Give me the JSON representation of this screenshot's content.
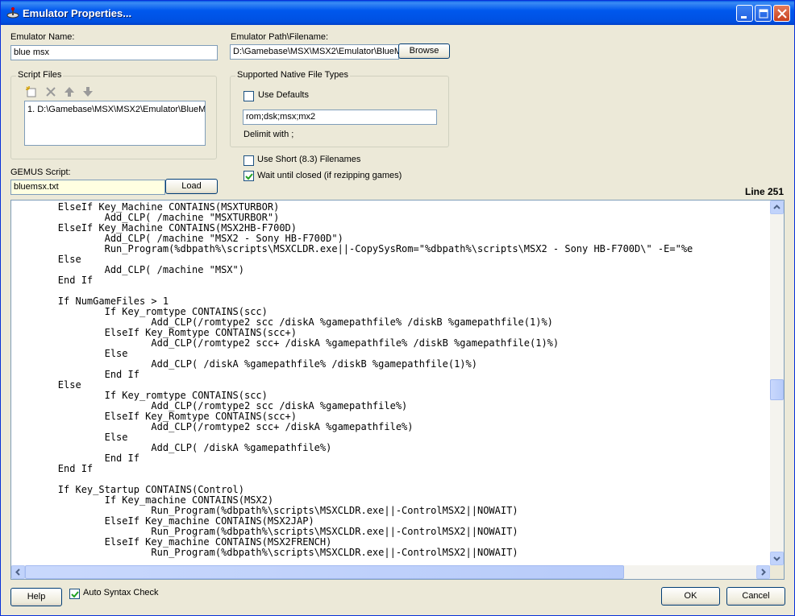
{
  "window": {
    "title": "Emulator Properties..."
  },
  "emulator_name": {
    "label": "Emulator Name:",
    "value": "blue msx"
  },
  "emulator_path": {
    "label": "Emulator Path\\Filename:",
    "value": "D:\\Gamebase\\MSX\\MSX2\\Emulator\\BlueM",
    "browse": "Browse"
  },
  "script_files": {
    "title": "Script Files",
    "items": [
      "1. D:\\Gamebase\\MSX\\MSX2\\Emulator\\BlueM"
    ]
  },
  "native_types": {
    "title": "Supported Native File Types",
    "use_defaults": "Use Defaults",
    "use_defaults_checked": false,
    "extensions": "rom;dsk;msx;mx2",
    "delimit": "Delimit with ;"
  },
  "options": {
    "short_names": "Use Short (8.3) Filenames",
    "short_names_checked": false,
    "wait_closed": "Wait until closed (if rezipping games)",
    "wait_closed_checked": true
  },
  "gemus": {
    "label": "GEMUS Script:",
    "value": "bluemsx.txt",
    "load": "Load",
    "line_indicator": "Line 251"
  },
  "code_lines": [
    "        ElseIf Key_Machine CONTAINS(MSXTURBOR)",
    "                Add_CLP( /machine \"MSXTURBOR\")",
    "        ElseIf Key_Machine CONTAINS(MSX2HB-F700D)",
    "                Add_CLP( /machine \"MSX2 - Sony HB-F700D\")",
    "                Run_Program(%dbpath%\\scripts\\MSXCLDR.exe||-CopySysRom=\"%dbpath%\\scripts\\MSX2 - Sony HB-F700D\\\" -E=\"%e",
    "        Else",
    "                Add_CLP( /machine \"MSX\")",
    "        End If",
    "",
    "        If NumGameFiles > 1",
    "                If Key_romtype CONTAINS(scc)",
    "                        Add_CLP(/romtype2 scc /diskA %gamepathfile% /diskB %gamepathfile(1)%)",
    "                ElseIf Key_Romtype CONTAINS(scc+)",
    "                        Add_CLP(/romtype2 scc+ /diskA %gamepathfile% /diskB %gamepathfile(1)%)",
    "                Else",
    "                        Add_CLP( /diskA %gamepathfile% /diskB %gamepathfile(1)%)",
    "                End If",
    "        Else",
    "                If Key_romtype CONTAINS(scc)",
    "                        Add_CLP(/romtype2 scc /diskA %gamepathfile%)",
    "                ElseIf Key_Romtype CONTAINS(scc+)",
    "                        Add_CLP(/romtype2 scc+ /diskA %gamepathfile%)",
    "                Else",
    "                        Add_CLP( /diskA %gamepathfile%)",
    "                End If",
    "        End If",
    "",
    "        If Key_Startup CONTAINS(Control)",
    "                If Key_machine CONTAINS(MSX2)",
    "                        Run_Program(%dbpath%\\scripts\\MSXCLDR.exe||-ControlMSX2||NOWAIT)",
    "                ElseIf Key_machine CONTAINS(MSX2JAP)",
    "                        Run_Program(%dbpath%\\scripts\\MSXCLDR.exe||-ControlMSX2||NOWAIT)",
    "                ElseIf Key_machine CONTAINS(MSX2FRENCH)",
    "                        Run_Program(%dbpath%\\scripts\\MSXCLDR.exe||-ControlMSX2||NOWAIT)"
  ],
  "footer": {
    "help": "Help",
    "auto_syntax": "Auto Syntax Check",
    "auto_syntax_checked": true,
    "ok": "OK",
    "cancel": "Cancel"
  }
}
